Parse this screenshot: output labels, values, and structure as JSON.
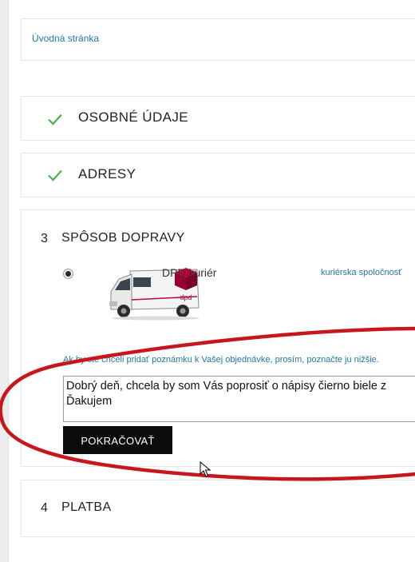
{
  "breadcrumb": {
    "home_link": "Úvodná stránka"
  },
  "steps": {
    "personal": {
      "title": "OSOBNÉ ÚDAJE",
      "icon": "checkmark-icon",
      "status_color": "#4caf50"
    },
    "addresses": {
      "title": "ADRESY",
      "icon": "checkmark-icon",
      "status_color": "#4caf50"
    },
    "shipping": {
      "number": "3",
      "title": "SPÔSOB DOPRAVY",
      "carrier": {
        "name": "DPD kuriér",
        "description": "kuriérska spoločnosť",
        "selected": true,
        "image": "dpd-van-image"
      },
      "note_label": "Ak by ste chceli pridať poznámku k Vašej objednávke, prosím, poznačte ju nižšie.",
      "note_value": "Dobrý deň, chcela by som Vás poprosiť o nápisy čierno biele z\nĎakujem",
      "continue_label": "POKRAČOVAŤ"
    },
    "payment": {
      "number": "4",
      "title": "PLATBA"
    }
  },
  "colors": {
    "link": "#2377a8",
    "annotation": "#c8161d",
    "button": "#0b0b0b"
  }
}
